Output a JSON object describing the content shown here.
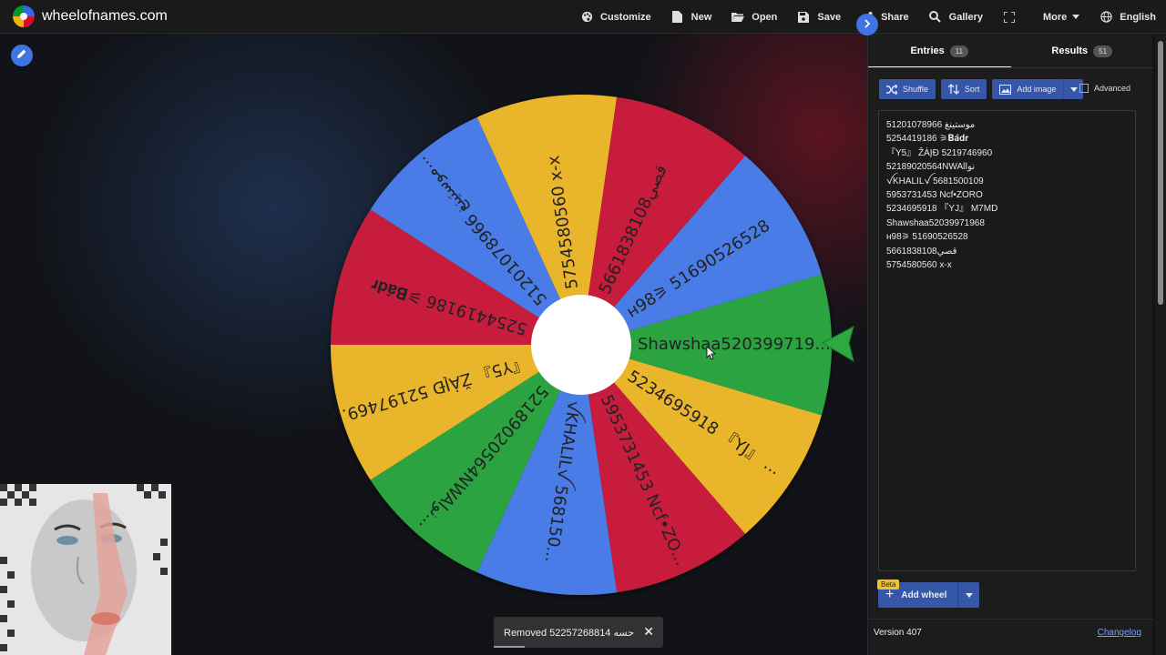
{
  "brand": {
    "name": "wheelofnames.com"
  },
  "nav": {
    "items": [
      {
        "label": "Customize",
        "icon": "palette-icon"
      },
      {
        "label": "New",
        "icon": "file-icon"
      },
      {
        "label": "Open",
        "icon": "folder-open-icon"
      },
      {
        "label": "Save",
        "icon": "save-icon"
      },
      {
        "label": "Share",
        "icon": "share-icon"
      },
      {
        "label": "Gallery",
        "icon": "search-icon"
      },
      {
        "label": "",
        "icon": "fullscreen-icon"
      },
      {
        "label": "More",
        "icon": "chevron-down-icon"
      },
      {
        "label": "English",
        "icon": "globe-icon"
      }
    ]
  },
  "wheel": {
    "colors": {
      "blue": "#4a7be6",
      "red": "#c81d3c",
      "yellow": "#e9b52c",
      "green": "#2aa33f"
    },
    "slices": [
      {
        "label": "Shawshaa520399719...",
        "color": "green"
      },
      {
        "label": "5234695918 『YJ』 ...",
        "color": "yellow"
      },
      {
        "label": "5953731453 Ncf•ZO...",
        "color": "red"
      },
      {
        "label": "ꪜKHALILꪜ 568150...",
        "color": "blue"
      },
      {
        "label": "52189020564NWAlنو...",
        "color": "green"
      },
      {
        "label": "『Y5』 ŽȦĮĐ 52197469...",
        "color": "yellow"
      },
      {
        "label": "5254419186 ⚞𝐁𝐚̂𝐝𝐫",
        "color": "red"
      },
      {
        "label": "51201078966 موستينغ...",
        "color": "blue"
      },
      {
        "label": "5754580560 x-x",
        "color": "yellow"
      },
      {
        "label": "56618381​08قصي",
        "color": "red"
      },
      {
        "label": "н98⚞ 51690526528",
        "color": "blue"
      }
    ]
  },
  "toast": {
    "message": "Removed 52257268814 حسه",
    "close": "✕"
  },
  "panel": {
    "tabs": [
      {
        "label": "Entries",
        "count": "11"
      },
      {
        "label": "Results",
        "count": "51"
      }
    ],
    "toolbar": {
      "shuffle": "Shuffle",
      "sort": "Sort",
      "add_image": "Add image",
      "advanced": "Advanced"
    },
    "entries": [
      "51201078966 موستينغ",
      "5254419186 ⚞𝐁𝐚̂𝐝𝐫",
      "『Y5』 ŽȦĮĐ 5219746960",
      "52189020564NWAlنوا",
      "ꪜKHALILꪜ 5681500109",
      "5953731453 Ncf•ZORO",
      "5234695918 『YJ』 M7MD",
      "Shawshaa52039971968",
      "н98⚞ 51690526528",
      "5661838108قصي",
      "5754580560 x-x"
    ],
    "beta": "Beta",
    "add_wheel": "Add wheel",
    "version": "Version 407",
    "changelog": "Changelog"
  }
}
